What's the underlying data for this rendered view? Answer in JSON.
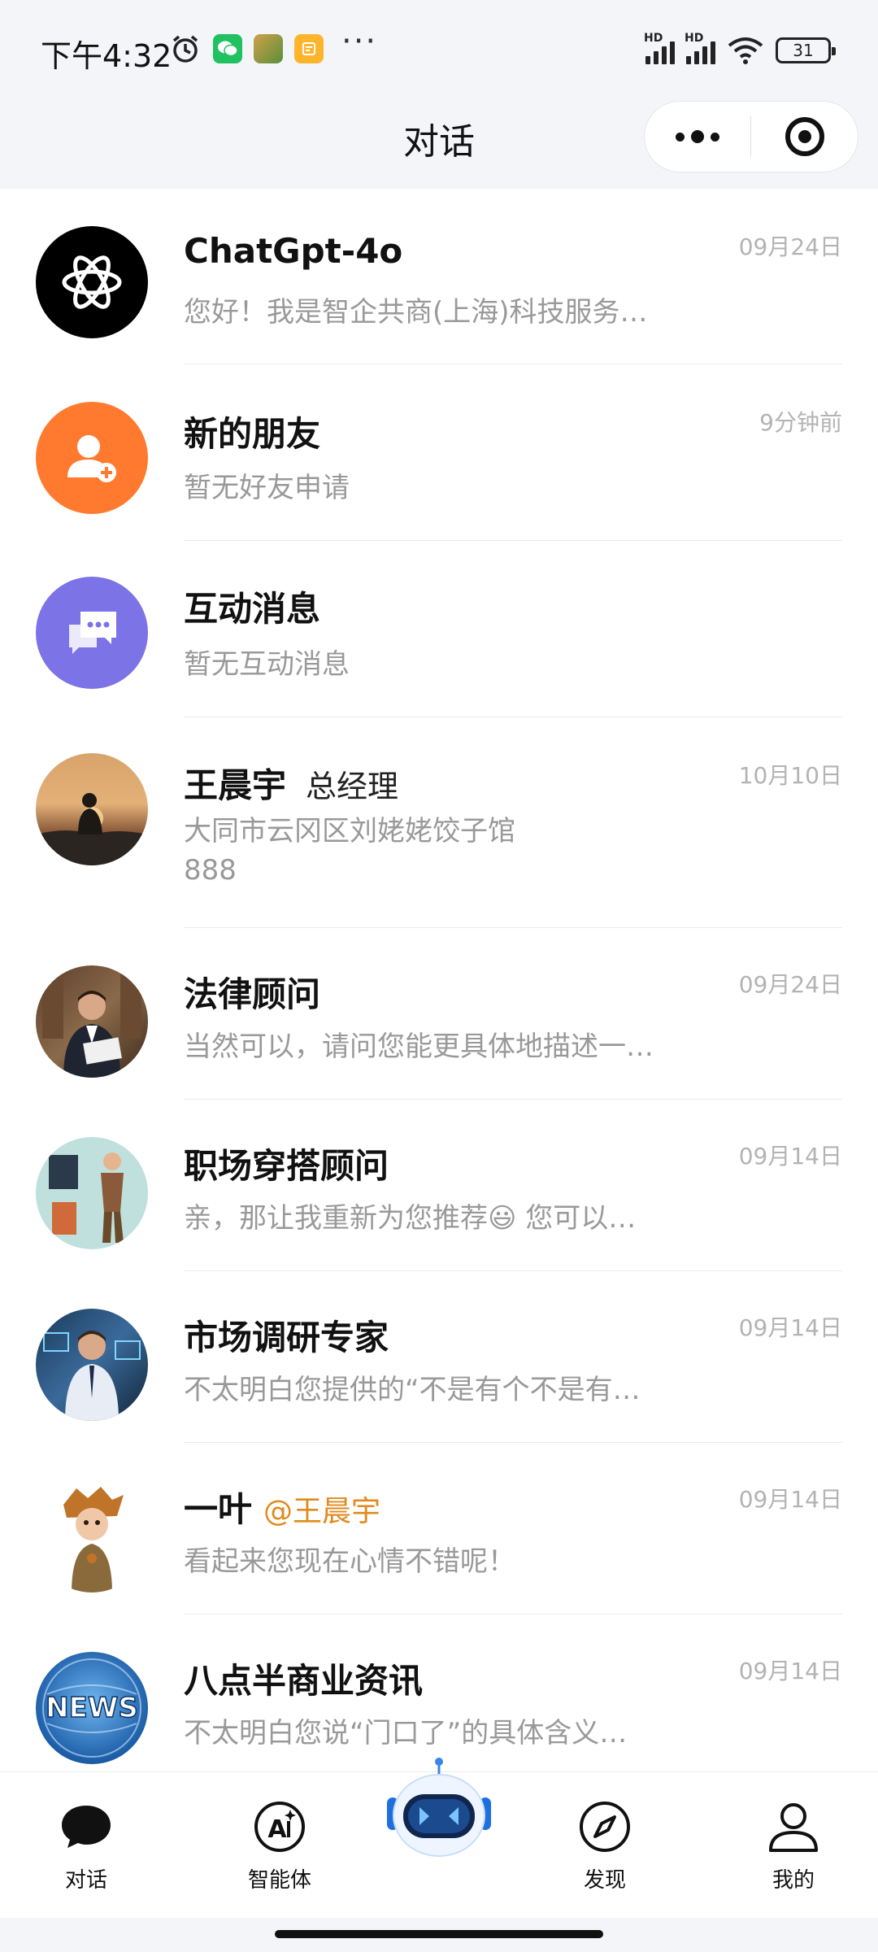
{
  "status_bar": {
    "time": "下午4:32",
    "more_indicator": "···",
    "battery": "31",
    "hd_labels": [
      "HD",
      "HD"
    ]
  },
  "header": {
    "title": "对话"
  },
  "chats": [
    {
      "name": "ChatGpt-4o",
      "time": "09月24日",
      "preview": "您好！我是智企共商(上海)科技服务…",
      "avatar_icon": "atom-icon"
    },
    {
      "name": "新的朋友",
      "time": "9分钟前",
      "preview": "暂无好友申请",
      "avatar_icon": "add-user-icon"
    },
    {
      "name": "互动消息",
      "time": "",
      "preview": "暂无互动消息",
      "avatar_icon": "chat-bubbles-icon"
    },
    {
      "name": "王晨宇",
      "subtitle": "总经理",
      "time": "10月10日",
      "preview": "大同市云冈区刘姥姥饺子馆",
      "preview_line2": "888",
      "avatar_icon": "sunset-person-photo"
    },
    {
      "name": "法律顾问",
      "time": "09月24日",
      "preview": "当然可以，请问您能更具体地描述一…",
      "avatar_icon": "lawyer-photo"
    },
    {
      "name": "职场穿搭顾问",
      "time": "09月14日",
      "preview": "亲，那让我重新为您推荐😃 您可以…",
      "avatar_icon": "fashion-advisor-photo"
    },
    {
      "name": "市场调研专家",
      "time": "09月14日",
      "preview": "不太明白您提供的“不是有个不是有…",
      "avatar_icon": "analyst-photo"
    },
    {
      "name": "一叶",
      "mention": "@王晨宇",
      "time": "09月14日",
      "preview": "看起来您现在心情不错呢！",
      "avatar_icon": "cartoon-character"
    },
    {
      "name": "八点半商业资讯",
      "time": "09月14日",
      "preview": "不太明白您说“门口了”的具体含义…",
      "avatar_icon": "news-globe",
      "avatar_text": "NEWS"
    }
  ],
  "tabs": [
    {
      "label": "对话",
      "icon": "chat-bubble-icon"
    },
    {
      "label": "智能体",
      "icon": "ai-sparkle-icon"
    },
    {
      "label": "",
      "icon": "robot-icon"
    },
    {
      "label": "发现",
      "icon": "compass-icon"
    },
    {
      "label": "我的",
      "icon": "user-icon"
    }
  ],
  "colors": {
    "header_bg": "#f4f5f9",
    "orange_avatar": "#ff7a2e",
    "purple_avatar": "#7c73e6",
    "mention": "#e08a1e",
    "muted": "#999999",
    "time": "#b3b3b3"
  }
}
